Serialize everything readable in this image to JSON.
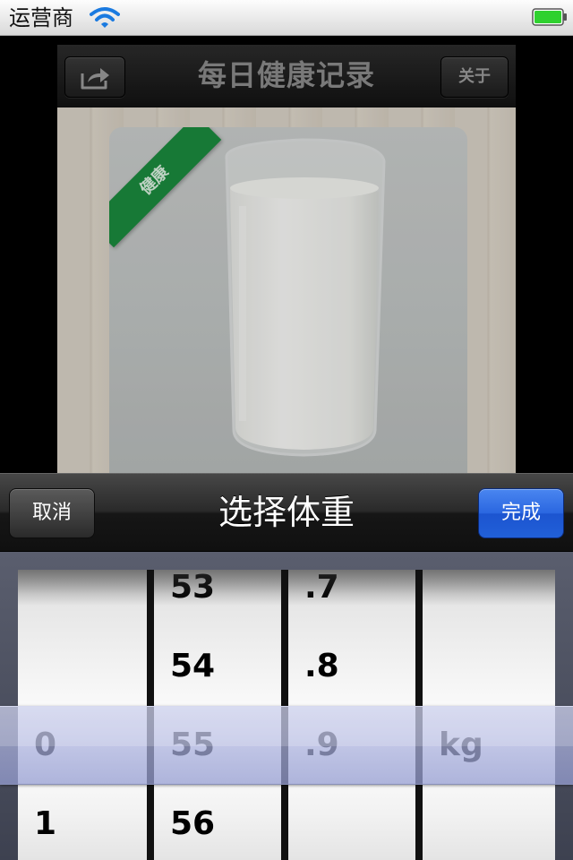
{
  "status_bar": {
    "carrier": "运营商",
    "wifi_icon": "wifi-icon",
    "battery_icon": "battery-full-icon",
    "battery_color": "#2fd12f"
  },
  "app": {
    "nav_title": "每日健康记录",
    "share_icon": "share-icon",
    "about_label": "关于",
    "ribbon_text": "健康"
  },
  "picker_bar": {
    "cancel_label": "取消",
    "title": "选择体重",
    "done_label": "完成",
    "done_color": "#2a66e0"
  },
  "picker": {
    "wheels": [
      {
        "name": "hundreds",
        "rows": [
          "",
          "",
          "0",
          "1"
        ],
        "selected": "0"
      },
      {
        "name": "units",
        "rows": [
          "53",
          "54",
          "55",
          "56"
        ],
        "selected": "55"
      },
      {
        "name": "decimal",
        "rows": [
          ".7",
          ".8",
          ".9",
          ""
        ],
        "selected": ".9"
      },
      {
        "name": "unit",
        "rows": [
          "",
          "",
          "kg",
          ""
        ],
        "selected": "kg"
      }
    ]
  }
}
